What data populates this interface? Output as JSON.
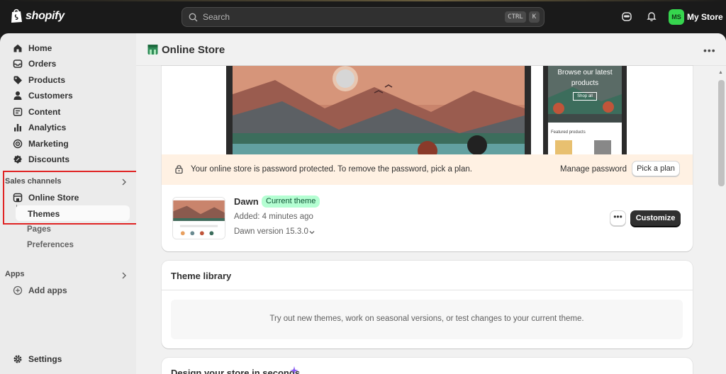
{
  "topbar": {
    "brand": "shopify",
    "search_placeholder": "Search",
    "shortcut_ctrl": "CTRL",
    "shortcut_key": "K",
    "avatar_initials": "MS",
    "store_name": "My Store"
  },
  "sidebar": {
    "items": [
      {
        "label": "Home",
        "icon": "home-icon"
      },
      {
        "label": "Orders",
        "icon": "orders-icon"
      },
      {
        "label": "Products",
        "icon": "tag-icon"
      },
      {
        "label": "Customers",
        "icon": "person-icon"
      },
      {
        "label": "Content",
        "icon": "content-icon"
      },
      {
        "label": "Analytics",
        "icon": "bar-chart-icon"
      },
      {
        "label": "Marketing",
        "icon": "target-icon"
      },
      {
        "label": "Discounts",
        "icon": "discount-icon"
      }
    ],
    "sales_channels_label": "Sales channels",
    "online_store_label": "Online Store",
    "themes_label": "Themes",
    "pages_label": "Pages",
    "preferences_label": "Preferences",
    "apps_label": "Apps",
    "add_apps_label": "Add apps",
    "settings_label": "Settings"
  },
  "main": {
    "title": "Online Store",
    "preview_headline": "Browse our latest products",
    "preview_button": "Shop all",
    "preview_featured": "Featured products",
    "banner": {
      "text": "Your online store is password protected. To remove the password, pick a plan.",
      "manage_password": "Manage password",
      "pick_plan": "Pick a plan"
    },
    "theme": {
      "name": "Dawn",
      "badge": "Current theme",
      "added": "Added: 4 minutes ago",
      "version": "Dawn version 15.3.0",
      "more_button": "•••",
      "customize": "Customize"
    },
    "library": {
      "title": "Theme library",
      "empty_text": "Try out new themes, work on seasonal versions, or test changes to your current theme."
    },
    "design": {
      "title": "Design your store in seconds"
    }
  },
  "colors": {
    "topbar_bg": "#1a1a1a",
    "sidebar_bg": "#ebebeb",
    "main_bg": "#f1f1f1",
    "banner_bg": "#fff1e3",
    "badge_bg": "#b4fed2",
    "avatar_bg": "#36d54e",
    "highlight": "#e02424",
    "primary_button": "#303030"
  }
}
